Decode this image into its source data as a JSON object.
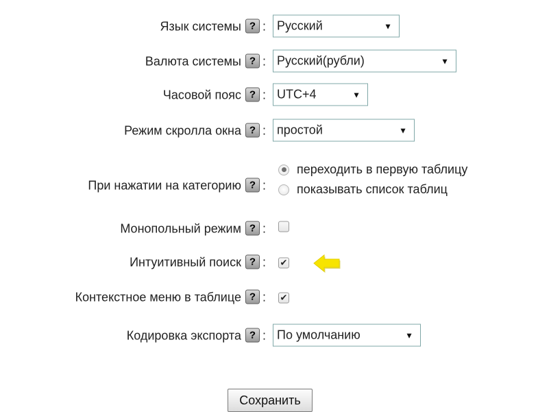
{
  "fields": {
    "language": {
      "label": "Язык системы",
      "help": "?",
      "value": "Русский"
    },
    "currency": {
      "label": "Валюта системы",
      "help": "?",
      "value": "Русский(рубли)"
    },
    "timezone": {
      "label": "Часовой пояс",
      "help": "?",
      "value": "UTC+4"
    },
    "scroll_mode": {
      "label": "Режим скролла окна",
      "help": "?",
      "value": "простой"
    },
    "category_click": {
      "label": "При нажатии на категорию",
      "help": "?",
      "options": [
        {
          "label": "переходить в первую таблицу",
          "checked": true
        },
        {
          "label": "показывать список таблиц",
          "checked": false
        }
      ]
    },
    "monopoly_mode": {
      "label": "Монопольный режим",
      "help": "?",
      "checked": false
    },
    "intuitive_search": {
      "label": "Интуитивный поиск",
      "help": "?",
      "checked": true
    },
    "context_menu": {
      "label": "Контекстное меню в таблице",
      "help": "?",
      "checked": true
    },
    "export_encoding": {
      "label": "Кодировка экспорта",
      "help": "?",
      "value": "По умолчанию"
    }
  },
  "colon": ":",
  "select_arrow": "▼",
  "check_mark": "✔",
  "save_label": "Сохранить",
  "colors": {
    "select_border": "#7fa7a7",
    "help_bg": "#b3b3b3",
    "arrow_fill": "#f7e400",
    "arrow_shadow": "#c8b800"
  },
  "icons": {
    "help": "help-question-icon",
    "pointer": "yellow-arrow-icon"
  }
}
